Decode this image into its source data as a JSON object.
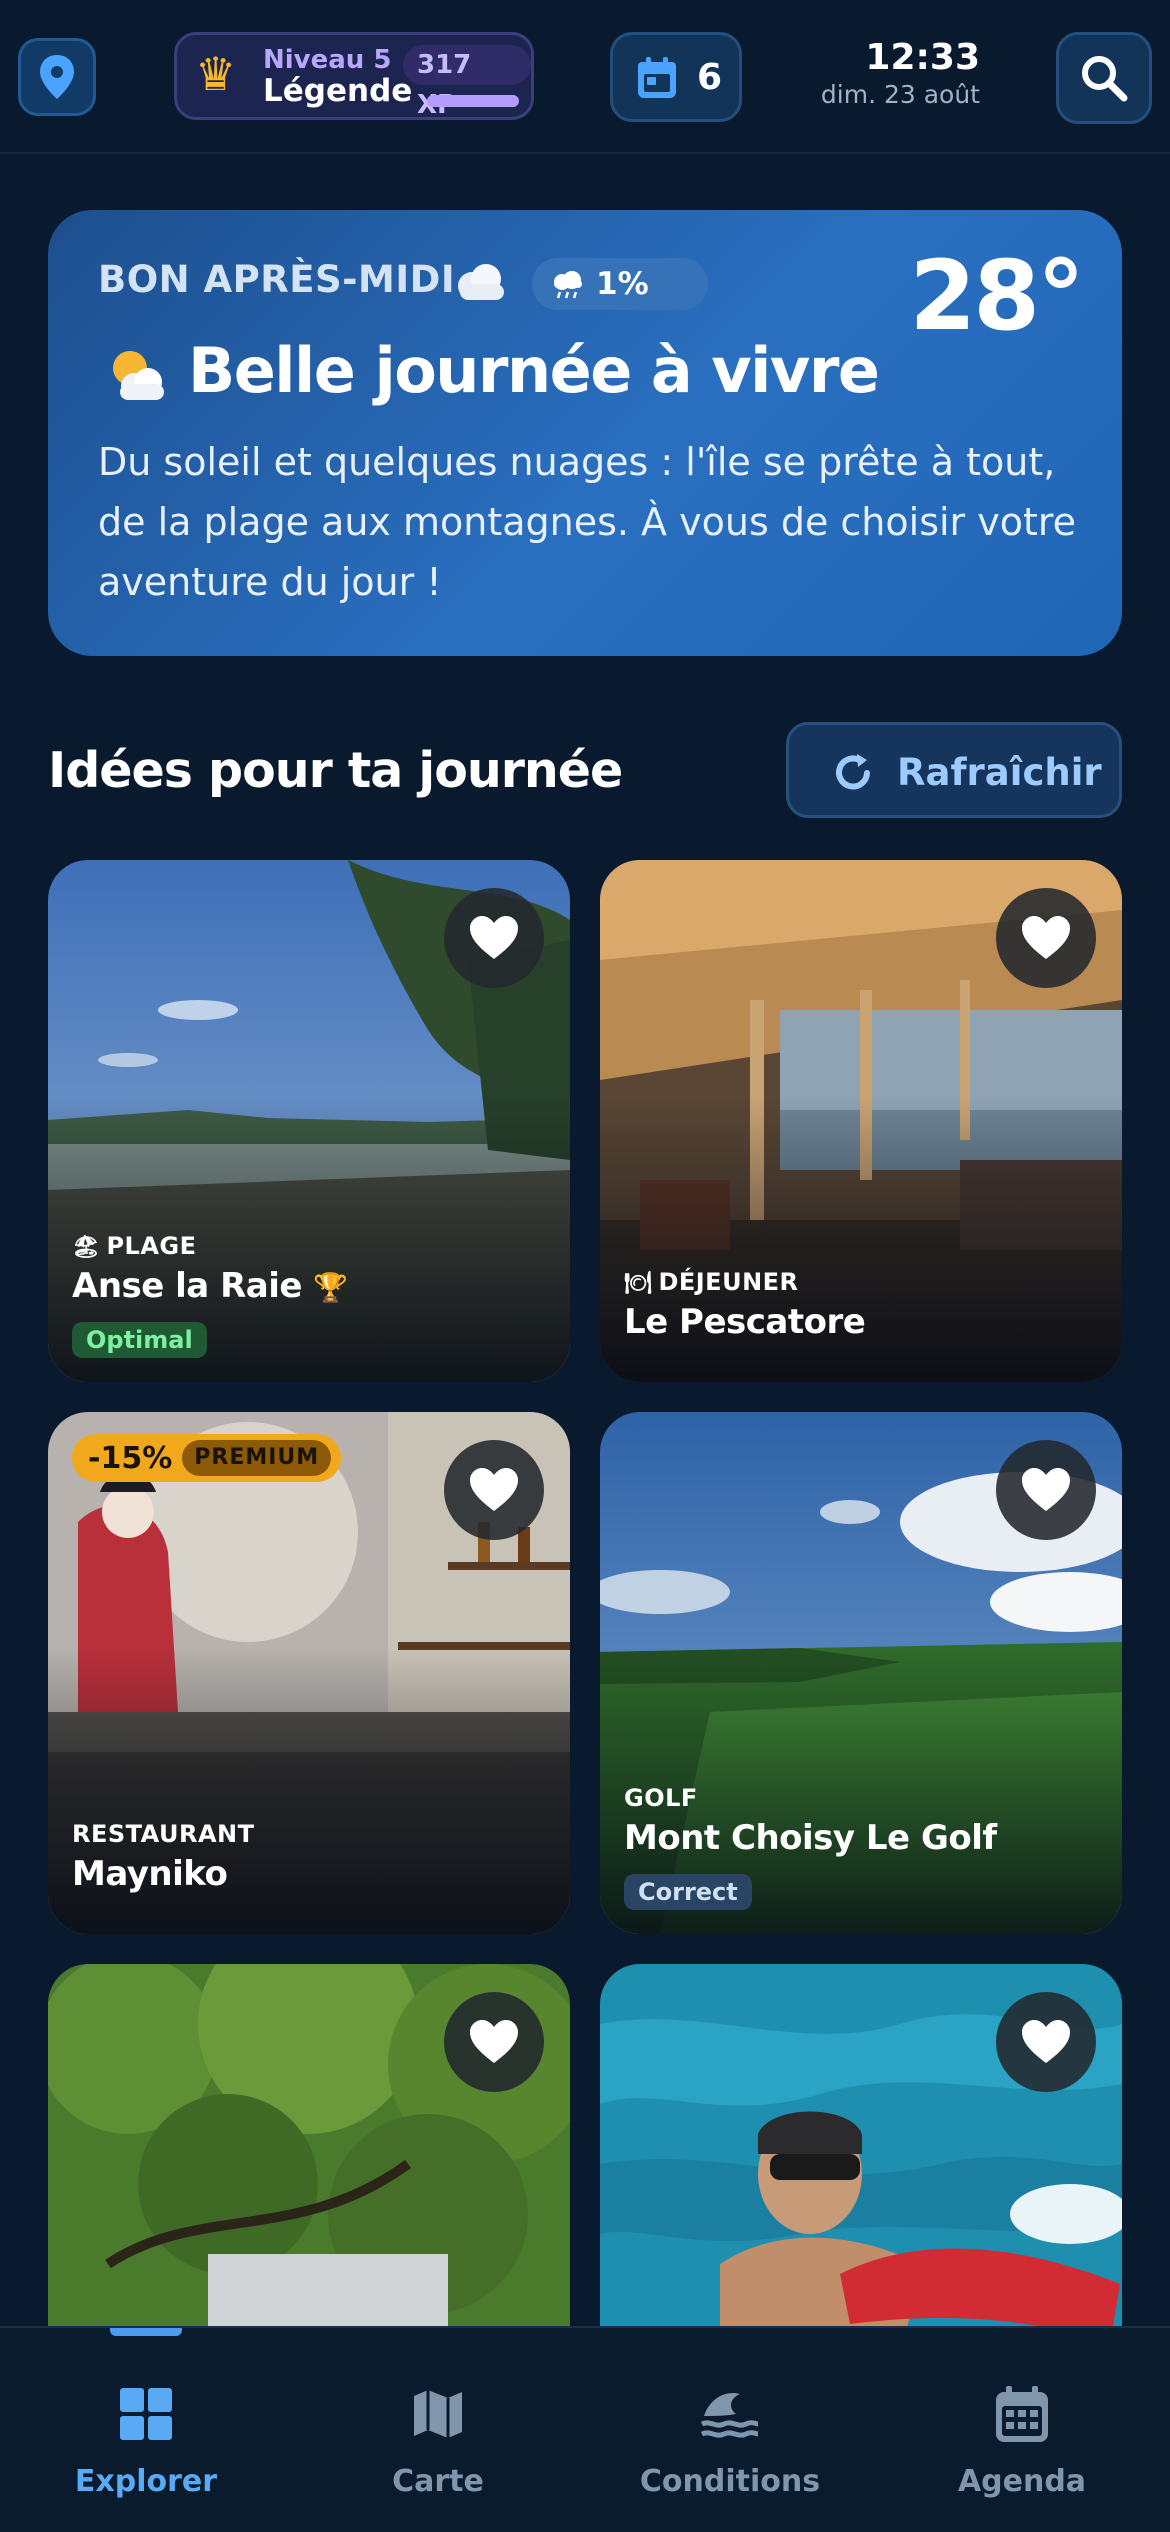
{
  "status": {
    "level_label": "Niveau 5",
    "rank": "Légende",
    "xp": "317 XP",
    "xp_progress": 0.5,
    "calendar_count": "6",
    "time": "12:33",
    "date": "dim. 23 août"
  },
  "weather": {
    "greeting": "BON APRÈS-MIDI",
    "rain_chance": "1%",
    "temperature": "28°",
    "title": "Belle journée à vivre",
    "description": "Du soleil et quelques nuages : l'île se prête à tout, de la plage aux montagnes. À vous de choisir votre aventure du jour !"
  },
  "ideas": {
    "title": "Idées pour ta journée",
    "refresh_label": "Rafraîchir",
    "cards": [
      {
        "category": "PLAGE",
        "category_emoji": "🏖",
        "name": "Anse la Raie",
        "name_suffix": "🏆",
        "status": "Optimal"
      },
      {
        "category": "DÉJEUNER",
        "category_emoji": "🍽",
        "name": "Le Pescatore"
      },
      {
        "category": "RESTAURANT",
        "name": "Mayniko",
        "promo": "-15%",
        "promo_tag": "PREMIUM"
      },
      {
        "category": "GOLF",
        "name": "Mont Choisy Le Golf",
        "status": "Correct"
      },
      {
        "name": ""
      },
      {
        "name": ""
      }
    ]
  },
  "nav": {
    "items": [
      {
        "label": "Explorer",
        "icon": "grid-icon"
      },
      {
        "label": "Carte",
        "icon": "map-icon"
      },
      {
        "label": "Conditions",
        "icon": "wave-icon"
      },
      {
        "label": "Agenda",
        "icon": "calendar-icon"
      }
    ]
  },
  "colors": {
    "background": "#0a1a2e",
    "accent": "#5aa9f5",
    "hero": "#2a6fc0",
    "optimal_badge": "#7ef0a0",
    "promo": "#f2a81c"
  }
}
